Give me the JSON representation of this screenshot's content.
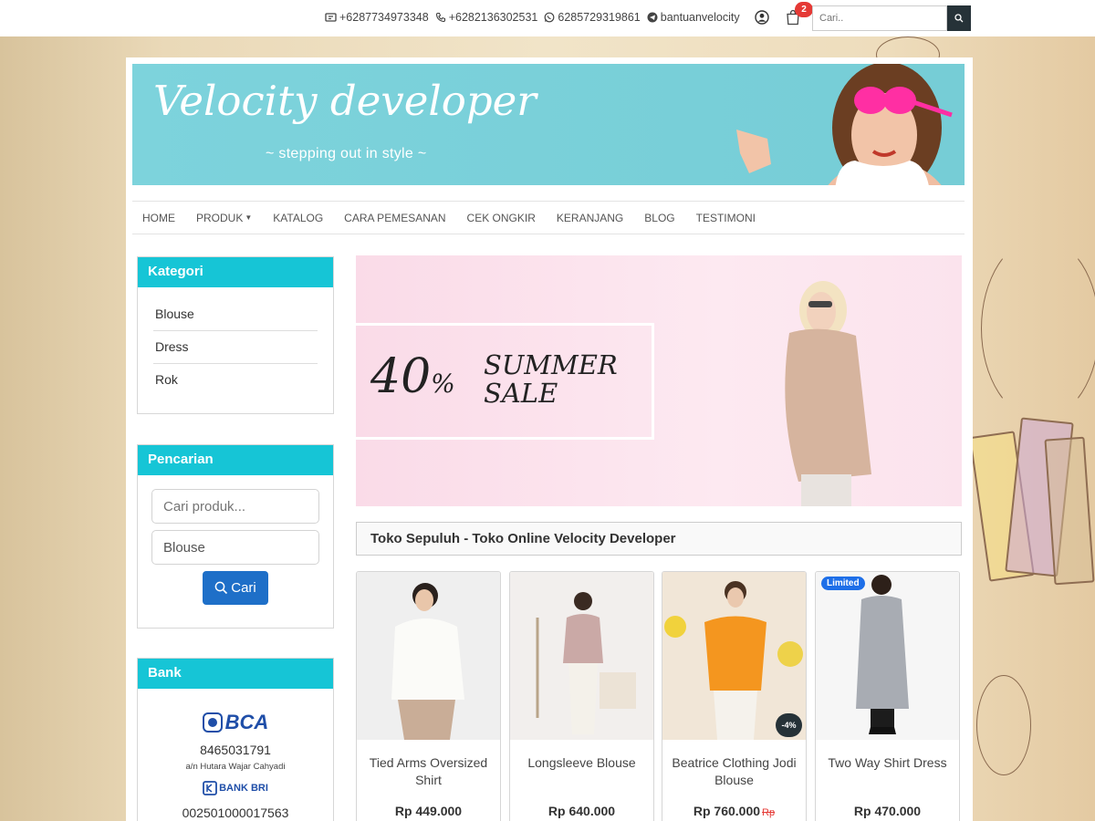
{
  "topbar": {
    "contacts": [
      {
        "icon": "fax-icon",
        "text": "+6287734973348"
      },
      {
        "icon": "phone-icon",
        "text": "+6282136302531"
      },
      {
        "icon": "whatsapp-icon",
        "text": "6285729319861"
      },
      {
        "icon": "telegram-icon",
        "text": "bantuanvelocity"
      }
    ],
    "cart_count": "2",
    "search_placeholder": "Cari.."
  },
  "header": {
    "site_title": "Velocity developer",
    "tagline": "~ stepping out in style ~",
    "accent_color": "#7dd3dc"
  },
  "nav": {
    "items": [
      {
        "label": "HOME"
      },
      {
        "label": "PRODUK",
        "has_dropdown": true
      },
      {
        "label": "KATALOG"
      },
      {
        "label": "CARA PEMESANAN"
      },
      {
        "label": "CEK ONGKIR"
      },
      {
        "label": "KERANJANG"
      },
      {
        "label": "BLOG"
      },
      {
        "label": "TESTIMONI"
      }
    ]
  },
  "sidebar": {
    "kategori": {
      "title": "Kategori",
      "items": [
        "Blouse",
        "Dress",
        "Rok"
      ]
    },
    "pencarian": {
      "title": "Pencarian",
      "search_placeholder": "Cari produk...",
      "category_value": "Blouse",
      "button_label": "Cari"
    },
    "bank": {
      "title": "Bank",
      "banks": [
        {
          "logo": "BCA",
          "number": "8465031791",
          "holder": "a/n Hutara Wajar Cahyadi"
        },
        {
          "logo": "BANK BRI",
          "number": "002501000017563"
        }
      ]
    },
    "header_color": "#16c5d6"
  },
  "promo": {
    "percent": "40",
    "percent_sign": "%",
    "text": "SUMMER SALE"
  },
  "store_title": "Toko Sepuluh - Toko Online Velocity Developer",
  "products": [
    {
      "name": "Tied Arms Oversized Shirt",
      "price": "Rp 449.000"
    },
    {
      "name": "Longsleeve Blouse",
      "price": "Rp 640.000"
    },
    {
      "name": "Beatrice Clothing Jodi Blouse",
      "price": "Rp 760.000",
      "old_price": "Rp",
      "discount": "-4%"
    },
    {
      "name": "Two Way Shirt Dress",
      "price": "Rp 470.000",
      "badge": "Limited"
    }
  ]
}
